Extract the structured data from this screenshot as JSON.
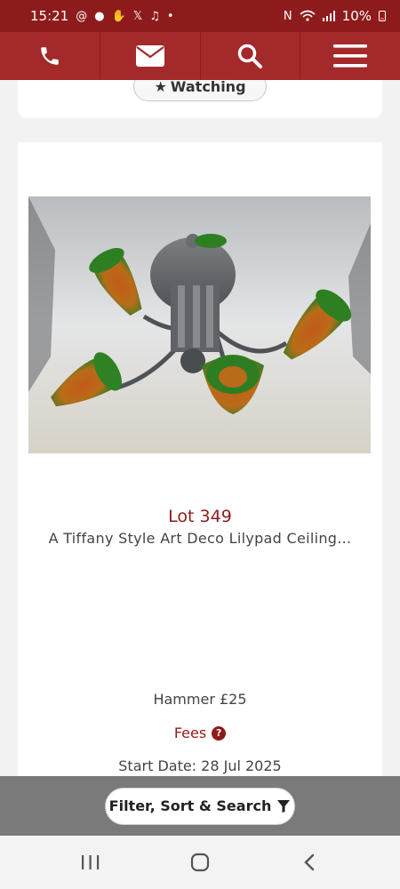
{
  "status_bar": {
    "time": "15:21",
    "battery": "10%"
  },
  "nav": {
    "items": [
      "phone-icon",
      "envelope-icon",
      "search-icon",
      "menu-icon"
    ]
  },
  "prev_card": {
    "watching_label": "Watching"
  },
  "lot": {
    "title": "Lot 349",
    "description": "A Tiffany Style Art Deco Lilypad Ceiling...",
    "hammer": "Hammer £25",
    "fees_label": "Fees",
    "start_date": "Start Date: 28 Jul 2025"
  },
  "filter": {
    "label": "Filter, Sort & Search"
  },
  "colors": {
    "brand_dark": "#8e1b1b",
    "brand": "#a3292a"
  }
}
